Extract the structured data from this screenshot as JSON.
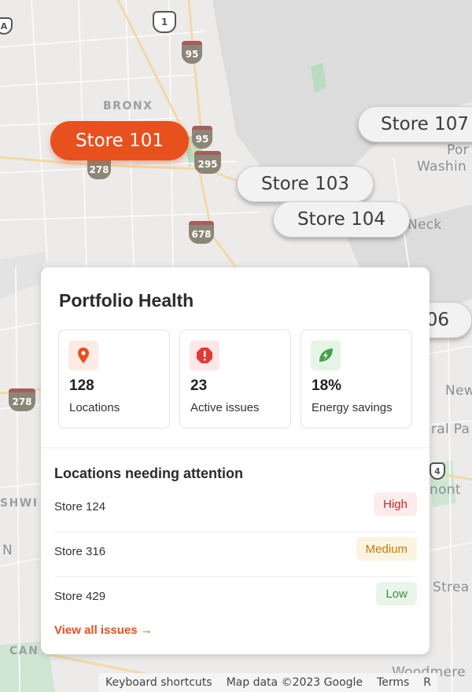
{
  "map": {
    "labels": {
      "bronx": "BRONX",
      "port_frag": "Por",
      "washington_frag": "Washin",
      "neck_frag": "Neck",
      "new_frag": "New",
      "ral_pa_frag": "ral Pa",
      "mont_frag": "nont",
      "street_frag": "Strea",
      "shwi_frag": "SHWI",
      "n_frag": "N",
      "can_frag": "CAN",
      "woodmere_frag": "Woodmere"
    },
    "shields": {
      "us1": "1",
      "i95a": "95",
      "i95b": "95",
      "i295": "295",
      "i278a": "278",
      "i678": "678",
      "i278b": "278",
      "r4": "4",
      "a": "A"
    }
  },
  "pins": {
    "store101": "Store 101",
    "store103": "Store 103",
    "store104": "Store 104",
    "store107": "Store 107",
    "store106": "06"
  },
  "card": {
    "title": "Portfolio Health",
    "stats": [
      {
        "value": "128",
        "label": "Locations",
        "icon": "location-pin-icon",
        "color": "#e8501e"
      },
      {
        "value": "23",
        "label": "Active issues",
        "icon": "alert-octagon-icon",
        "color": "#e53935"
      },
      {
        "value": "18%",
        "label": "Energy savings",
        "icon": "energy-leaf-icon",
        "color": "#43a047"
      }
    ],
    "attention_title": "Locations needing attention",
    "locations": [
      {
        "name": "Store 124",
        "severity": "High"
      },
      {
        "name": "Store 316",
        "severity": "Medium"
      },
      {
        "name": "Store 429",
        "severity": "Low"
      }
    ],
    "view_all": "View all issues →"
  },
  "footer": {
    "shortcuts": "Keyboard shortcuts",
    "map_data": "Map data ©2023 Google",
    "terms": "Terms",
    "report": "R"
  },
  "colors": {
    "accent": "#e8501e",
    "high_bg": "#fdecec",
    "high_fg": "#c62828",
    "medium_bg": "#fdf3e1",
    "medium_fg": "#c77b0a",
    "low_bg": "#eaf5ea",
    "low_fg": "#3b8a3e"
  }
}
